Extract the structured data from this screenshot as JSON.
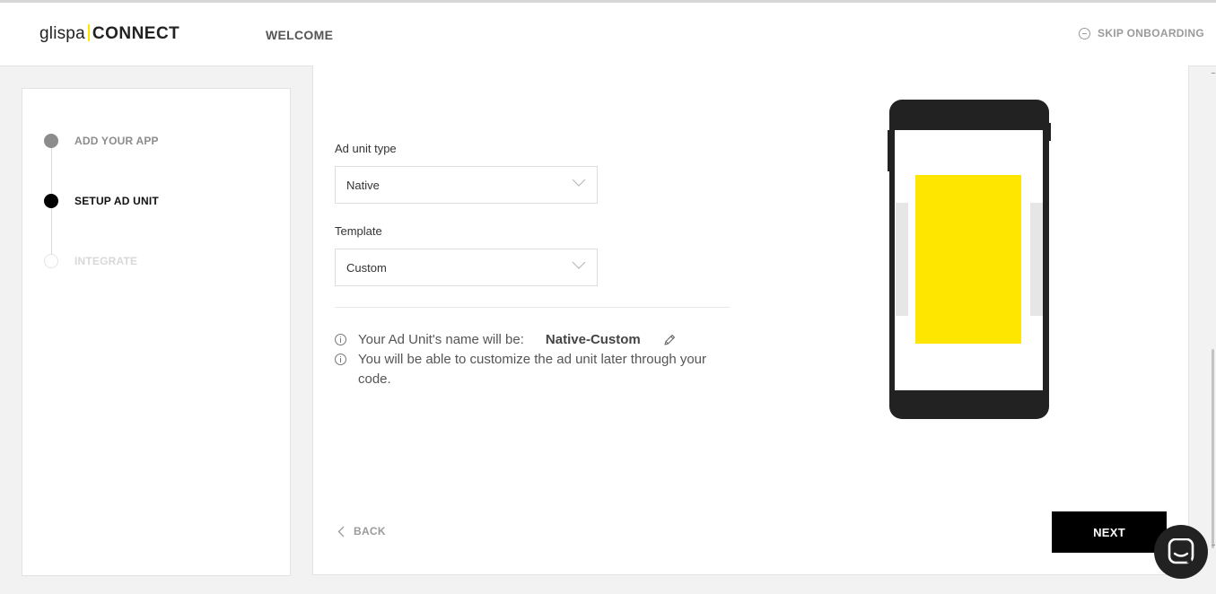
{
  "header": {
    "logo_first": "glispa",
    "logo_second": "CONNECT",
    "welcome": "WELCOME",
    "skip_label": "SKIP ONBOARDING"
  },
  "steps": [
    {
      "label": "ADD YOUR APP",
      "state": "done"
    },
    {
      "label": "SETUP AD UNIT",
      "state": "active"
    },
    {
      "label": "INTEGRATE",
      "state": "pending"
    }
  ],
  "form": {
    "ad_unit_type_label": "Ad unit type",
    "ad_unit_type_value": "Native",
    "template_label": "Template",
    "template_value": "Custom"
  },
  "info": {
    "name_prefix": "Your Ad Unit's name will be:",
    "name_value": "Native-Custom",
    "customize_note": "You will be able to customize the ad unit later through your code."
  },
  "nav": {
    "back_label": "BACK",
    "next_label": "NEXT"
  },
  "colors": {
    "accent_yellow": "#ffe600",
    "active_black": "#000000",
    "phone_body": "#222222"
  },
  "icons": [
    "minus-circle-icon",
    "info-icon",
    "pencil-icon",
    "chevron-down-icon",
    "chevron-left-icon",
    "chat-icon"
  ]
}
